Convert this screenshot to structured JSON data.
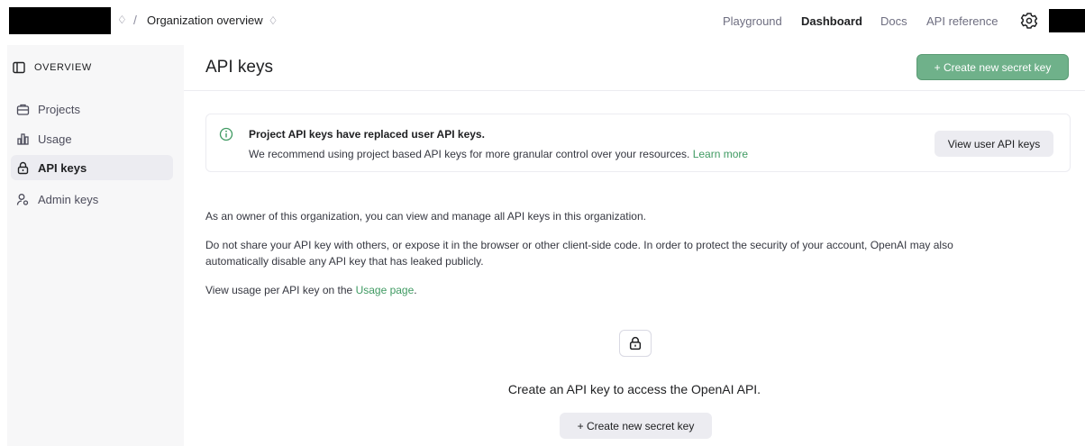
{
  "topbar": {
    "org_chevron": "♢",
    "separator": "/",
    "breadcrumb": "Organization overview",
    "breadcrumb_chevron": "♢",
    "nav": [
      "Playground",
      "Dashboard",
      "Docs",
      "API reference"
    ],
    "active_nav": "Dashboard"
  },
  "sidebar": {
    "heading": "OVERVIEW",
    "items": [
      {
        "label": "Projects",
        "icon": "briefcase-icon"
      },
      {
        "label": "Usage",
        "icon": "bar-chart-icon"
      },
      {
        "label": "API keys",
        "icon": "lock-icon",
        "active": true
      },
      {
        "label": "Admin keys",
        "icon": "user-key-icon"
      }
    ]
  },
  "main": {
    "title": "API keys",
    "create_button": "+ Create new secret key",
    "notice": {
      "title": "Project API keys have replaced user API keys.",
      "body": "We recommend using project based API keys for more granular control over your resources.",
      "link": "Learn more",
      "button": "View user API keys"
    },
    "paragraph1": "As an owner of this organization, you can view and manage all API keys in this organization.",
    "paragraph2_line1": "Do not share your API key with others, or expose it in the browser or other client-side code. In order to protect the security of your account, OpenAI may also",
    "paragraph2_line2": "automatically disable any API key that has leaked publicly.",
    "paragraph3_prefix": "View usage per API key on the",
    "paragraph3_link": "Usage page",
    "paragraph3_suffix": ".",
    "empty_state": {
      "title": "Create an API key to access the OpenAI API.",
      "button": "+ Create new secret key"
    }
  },
  "colors": {
    "accent_green": "#6fb18a",
    "link_green": "#3f9a62",
    "sidebar_bg": "#f7f7f8",
    "active_item_bg": "#ececf1"
  }
}
